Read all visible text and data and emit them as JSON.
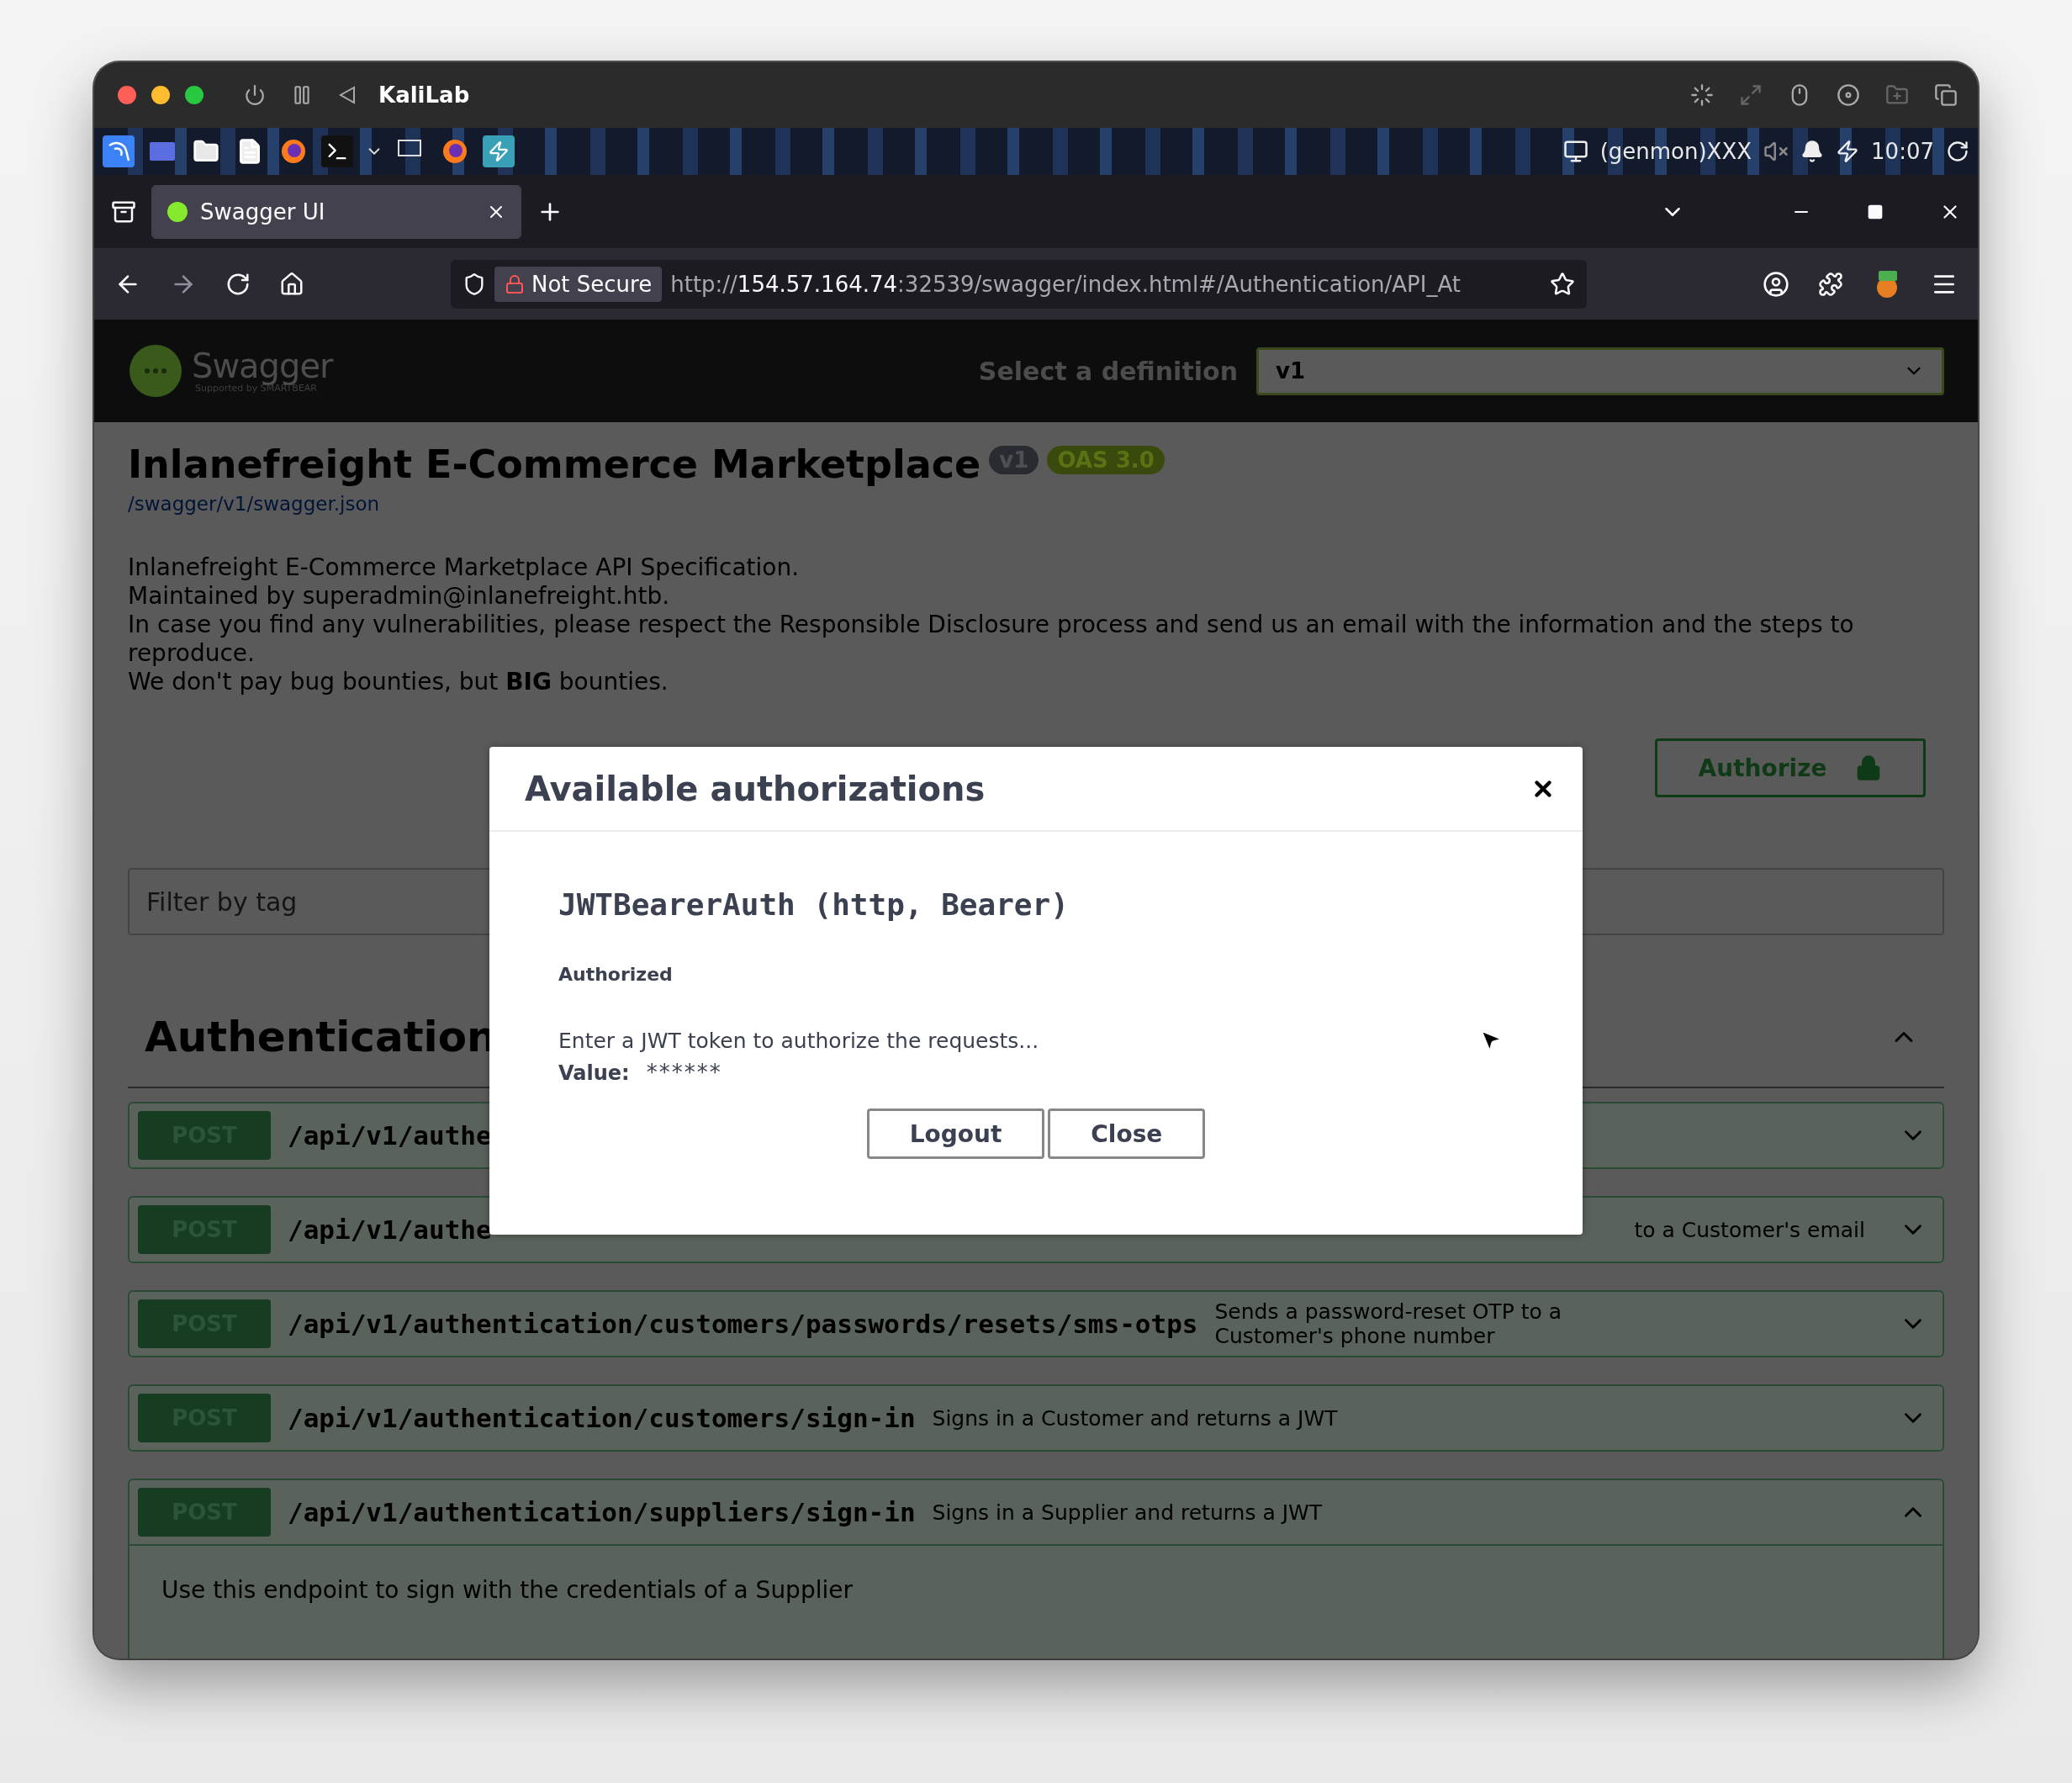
{
  "window": {
    "title": "KaliLab"
  },
  "taskbar": {
    "genmon": "(genmon)XXX",
    "clock": "10:07"
  },
  "browser": {
    "tabs": [
      {
        "title": "Swagger UI",
        "selected": true
      }
    ],
    "security_label": "Not Secure",
    "url": {
      "scheme": "http://",
      "host": "154.57.164.74",
      "path": ":32539/swagger/index.html#/Authentication/API_At"
    }
  },
  "swagger": {
    "logo_text": "Swagger",
    "logo_subtext": "Supported by SMARTBEAR",
    "definition_label": "Select a definition",
    "definition_value": "v1"
  },
  "info": {
    "title": "Inlanefreight E-Commerce Marketplace",
    "version": "v1",
    "oas": "OAS 3.0",
    "spec_link": "/swagger/v1/swagger.json",
    "description_lines": [
      "Inlanefreight E-Commerce Marketplace API Specification.",
      "Maintained by superadmin@inlanefreight.htb.",
      "In case you find any vulnerabilities, please respect the Responsible Disclosure process and send us an email with the information and the steps to reproduce.",
      "We don't pay bug bounties, but **BIG** bounties."
    ]
  },
  "authorize_button": "Authorize",
  "filter": {
    "placeholder": "Filter by tag"
  },
  "tag": {
    "name": "Authentication",
    "expanded": true,
    "operations": [
      {
        "method": "POST",
        "path": "/api/v1/authe",
        "expanded": false
      },
      {
        "method": "POST",
        "path": "/api/v1/authe",
        "summary": "to a Customer's email",
        "align_end": true,
        "expanded": false
      },
      {
        "method": "POST",
        "path": "/api/v1/authentication/customers/passwords/resets/sms-otps",
        "summary": "Sends a password-reset OTP to a Customer's phone number",
        "expanded": false
      },
      {
        "method": "POST",
        "path": "/api/v1/authentication/customers/sign-in",
        "summary": "Signs in a Customer and returns a JWT",
        "expanded": false
      },
      {
        "method": "POST",
        "path": "/api/v1/authentication/suppliers/sign-in",
        "summary": "Signs in a Supplier and returns a JWT",
        "expanded": true,
        "body": "Use this endpoint to sign with the credentials of a Supplier"
      }
    ]
  },
  "dialog": {
    "title": "Available authorizations",
    "scheme_name": "JWTBearerAuth",
    "scheme_type": "(http, Bearer)",
    "status": "Authorized",
    "hint": "Enter a JWT token to authorize the requests...",
    "value_label": "Value:",
    "value": "******",
    "buttons": [
      "Logout",
      "Close"
    ]
  }
}
